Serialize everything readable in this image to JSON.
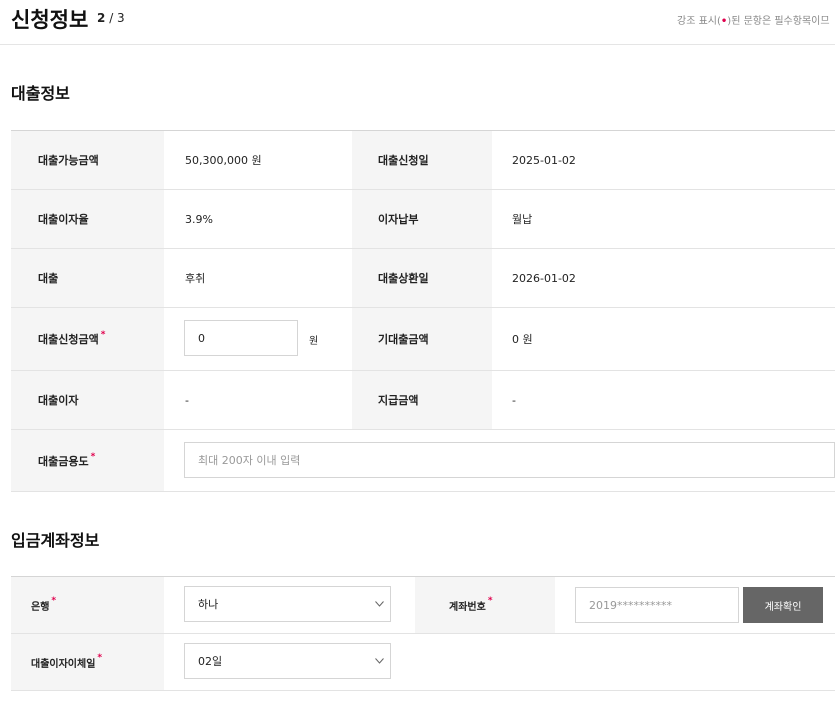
{
  "header": {
    "title": "신청정보",
    "step_current": "2",
    "step_total": "/ 3",
    "notice_pre": "강조 표시(",
    "notice_mark": "•",
    "notice_post": ")된 문항은 필수항목이므"
  },
  "loan": {
    "section_title": "대출정보",
    "available_label": "대출가능금액",
    "available_value": "50,300,000 원",
    "apply_date_label": "대출신청일",
    "apply_date_value": "2025-01-02",
    "rate_label": "대출이자율",
    "rate_value": "3.9%",
    "interest_pay_label": "이자납부",
    "interest_pay_value": "월납",
    "loan_label": "대출",
    "loan_value": "후취",
    "repay_date_label": "대출상환일",
    "repay_date_value": "2026-01-02",
    "request_amount_label": "대출신청금액",
    "request_amount_value": "0",
    "request_amount_unit": "원",
    "expected_label": "기대출금액",
    "expected_value": "0 원",
    "interest_label": "대출이자",
    "interest_value": "-",
    "payment_label": "지급금액",
    "payment_value": "-",
    "purpose_label": "대출금용도",
    "purpose_placeholder": "최대 200자 이내 입력"
  },
  "account": {
    "section_title": "입금계좌정보",
    "bank_label": "은행",
    "bank_value": "하나",
    "account_no_label": "계좌번호",
    "account_no_placeholder": "2019**********",
    "verify_button": "계좌확인",
    "interest_day_label": "대출이자이체일",
    "interest_day_value": "02일"
  },
  "colors": {
    "required": "#e0004d",
    "button_bg": "#666666",
    "header_cell_bg": "#f5f5f5"
  }
}
